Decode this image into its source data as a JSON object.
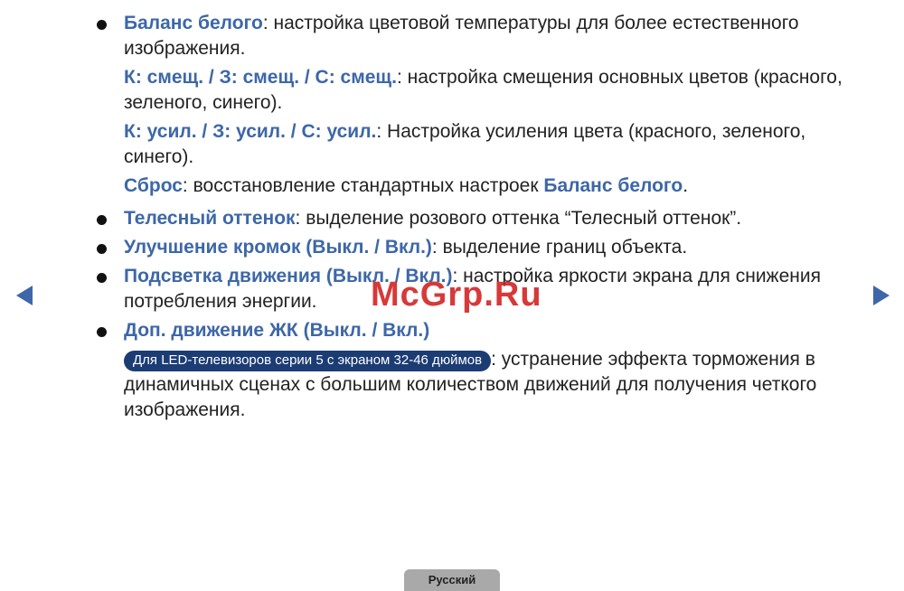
{
  "items": [
    {
      "term": "Баланс белого",
      "desc": ": настройка цветовой температуры для более естественного изображения.",
      "subs": [
        {
          "term": "К: смещ. / З: смещ. / С: смещ.",
          "desc": ": настройка смещения основных цветов (красного, зеленого, синего)."
        },
        {
          "term": "К: усил. / З: усил. / С: усил.",
          "desc": ": Настройка усиления цвета (красного, зеленого, синего)."
        },
        {
          "term": "Сброс",
          "desc": ": восстановление стандартных настроек ",
          "term2": "Баланс белого",
          "tail": "."
        }
      ]
    },
    {
      "term": "Телесный оттенок",
      "desc": ": выделение розового оттенка “Телесный оттенок”."
    },
    {
      "term": "Улучшение кромок (Выкл. / Вкл.)",
      "desc": ": выделение границ объекта."
    },
    {
      "term": "Подсветка движения (Выкл. / Вкл.)",
      "desc": ": настройка яркости экрана для снижения потребления энергии."
    },
    {
      "term": "Доп. движение ЖК (Выкл. / Вкл.)",
      "badge": "Для LED-телевизоров серии 5 с экраном 32-46 дюймов",
      "desc": ": устранение эффекта торможения в динамичных сценах с большим количеством движений для получения четкого изображения."
    }
  ],
  "watermark": "McGrp.Ru",
  "footer": {
    "language": "Русский"
  },
  "icons": {
    "prev": "triangle-left-icon",
    "next": "triangle-right-icon"
  },
  "colors": {
    "accent": "#3d67a8",
    "badge": "#1c3c74",
    "tab": "#a9a9a9"
  }
}
